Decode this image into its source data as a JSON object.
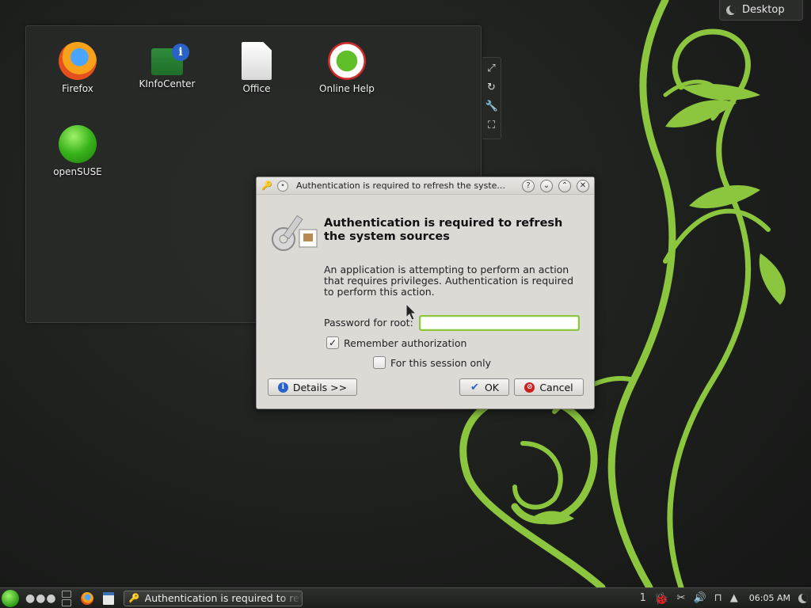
{
  "desktop": {
    "activity_label": "Desktop",
    "icons": [
      {
        "label": "Firefox",
        "icon": "firefox-icon"
      },
      {
        "label": "KInfoCenter",
        "icon": "kinfocenter-icon"
      },
      {
        "label": "Office",
        "icon": "office-icon"
      },
      {
        "label": "Online Help",
        "icon": "online-help-icon"
      },
      {
        "label": "openSUSE",
        "icon": "opensuse-icon"
      }
    ],
    "folder_tools": [
      "resize-icon",
      "rotate-icon",
      "configure-icon",
      "maximize-icon"
    ]
  },
  "dialog": {
    "title": "Authentication is required to refresh the syste...",
    "headline": "Authentication is required to refresh the system sources",
    "body": "An application is attempting to perform an action that requires privileges. Authentication is required to perform this action.",
    "password_label": "Password for root:",
    "password_value": "",
    "remember_label": "Remember authorization",
    "remember_checked": true,
    "session_label": "For this session only",
    "session_checked": false,
    "details_button": "Details >>",
    "ok_button": "OK",
    "cancel_button": "Cancel",
    "title_buttons": [
      "help-icon",
      "minimize-icon",
      "maximize-icon",
      "close-icon"
    ]
  },
  "taskbar": {
    "task_label": "Authentication is required to refresh the system sources",
    "desktop_number": "1",
    "clock": "06:05 AM"
  },
  "colors": {
    "accent_green": "#8cc63f",
    "wallpaper_dark": "#1d1f1d",
    "dialog_bg": "#dcdad5"
  }
}
